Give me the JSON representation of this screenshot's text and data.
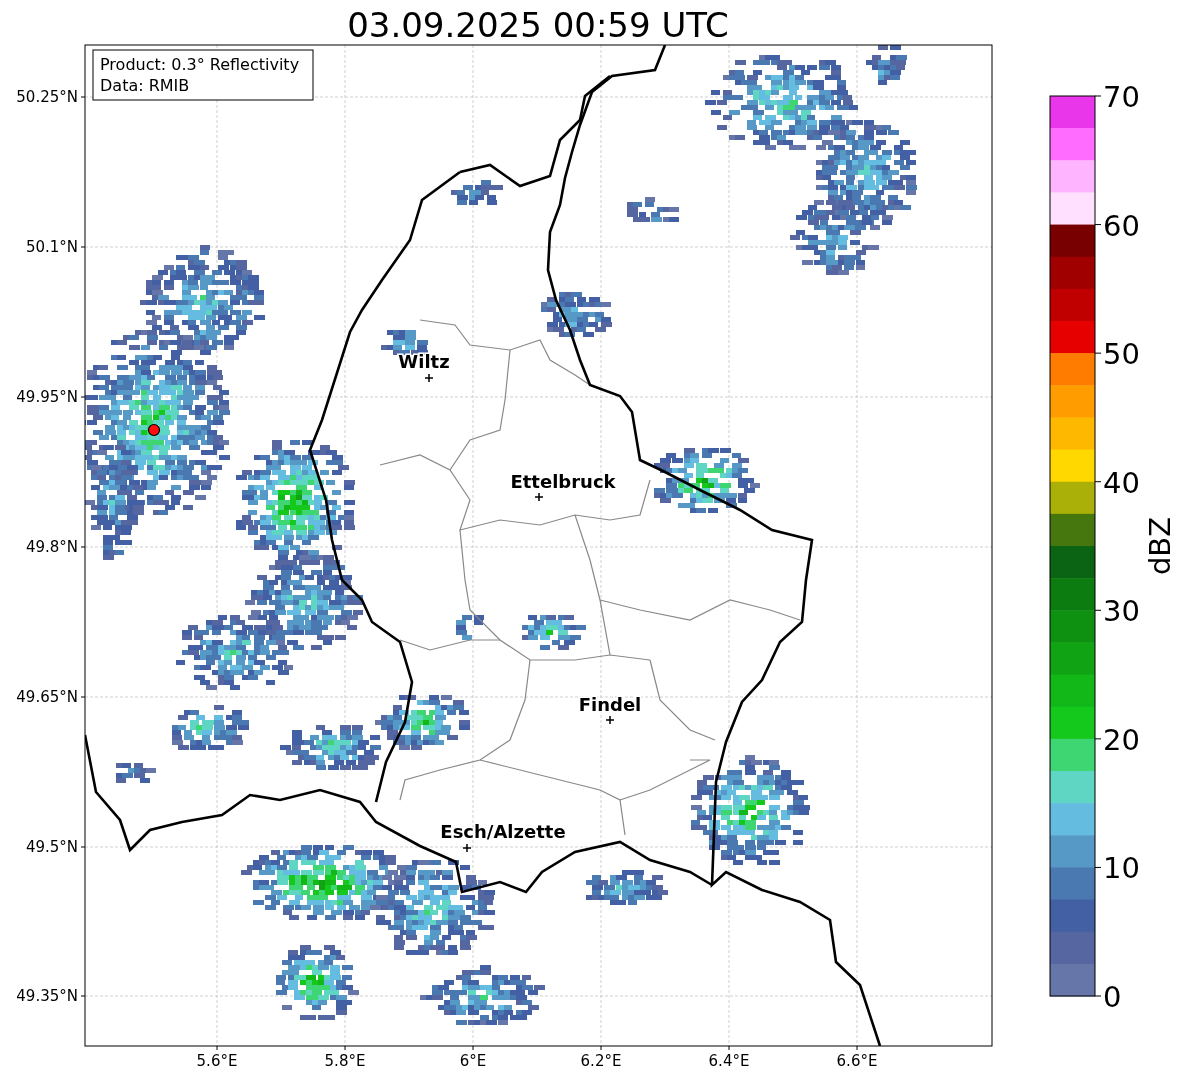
{
  "title": "03.09.2025 00:59 UTC",
  "info_box": [
    "Product: 0.3° Reflectivity",
    "Data: RMIB"
  ],
  "map": {
    "x_ticks": [
      "5.6°E",
      "5.8°E",
      "6°E",
      "6.2°E",
      "6.4°E",
      "6.6°E"
    ],
    "y_ticks": [
      "50.25°N",
      "50.1°N",
      "49.95°N",
      "49.8°N",
      "49.65°N",
      "49.5°N",
      "49.35°N"
    ],
    "cities": [
      {
        "name": "Wiltz"
      },
      {
        "name": "Ettelbruck"
      },
      {
        "name": "Findel"
      },
      {
        "name": "Esch/Alzette"
      }
    ]
  },
  "colorbar": {
    "label": "dBZ",
    "ticks": [
      "70",
      "60",
      "50",
      "40",
      "30",
      "20",
      "10",
      "0"
    ],
    "bins": [
      {
        "color": "#ea36ea"
      },
      {
        "color": "#ff6cff"
      },
      {
        "color": "#ffb4ff"
      },
      {
        "color": "#ffe0ff"
      },
      {
        "color": "#780000"
      },
      {
        "color": "#a00000"
      },
      {
        "color": "#c00000"
      },
      {
        "color": "#e60000"
      },
      {
        "color": "#ff7c00"
      },
      {
        "color": "#ff9c00"
      },
      {
        "color": "#ffb800"
      },
      {
        "color": "#ffd800"
      },
      {
        "color": "#aab008"
      },
      {
        "color": "#46760e"
      },
      {
        "color": "#0a6414"
      },
      {
        "color": "#0c7c10"
      },
      {
        "color": "#0e9010"
      },
      {
        "color": "#10a414"
      },
      {
        "color": "#12b818"
      },
      {
        "color": "#14c81c"
      },
      {
        "color": "#3dd672"
      },
      {
        "color": "#5fd6c4"
      },
      {
        "color": "#64bce0"
      },
      {
        "color": "#5698c6"
      },
      {
        "color": "#4a78b0"
      },
      {
        "color": "#4460a4"
      },
      {
        "color": "#5566a0"
      },
      {
        "color": "#6676a8"
      }
    ]
  }
}
